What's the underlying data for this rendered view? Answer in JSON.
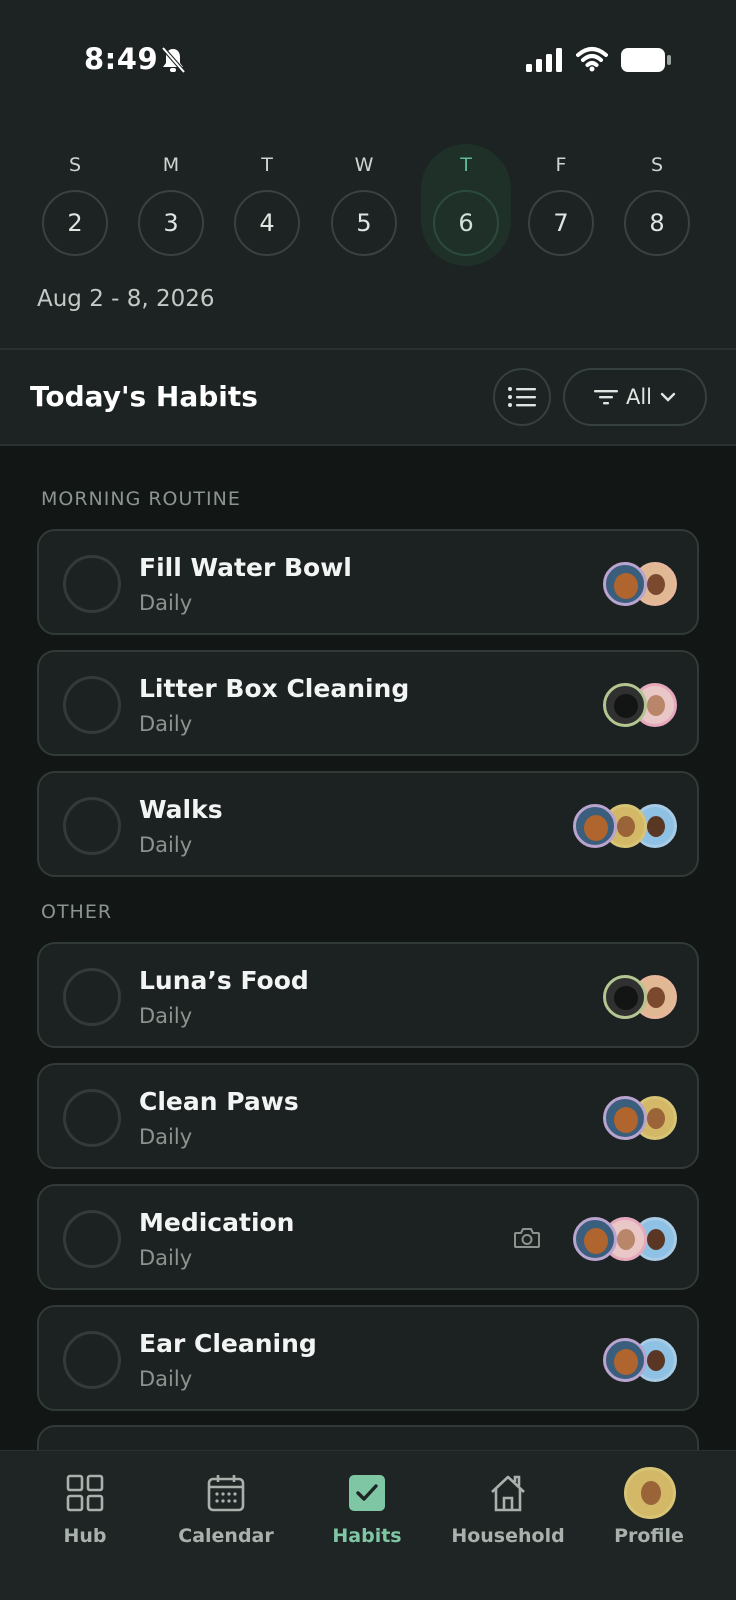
{
  "status_bar": {
    "time": "8:49"
  },
  "week": {
    "days": [
      {
        "dow": "S",
        "num": "2"
      },
      {
        "dow": "M",
        "num": "3"
      },
      {
        "dow": "T",
        "num": "4"
      },
      {
        "dow": "W",
        "num": "5"
      },
      {
        "dow": "T",
        "num": "6",
        "selected": true
      },
      {
        "dow": "F",
        "num": "7"
      },
      {
        "dow": "S",
        "num": "8"
      }
    ],
    "range": "Aug 2 - 8, 2026"
  },
  "habits_header": {
    "title": "Today's Habits",
    "filter_label": "All"
  },
  "sections": [
    {
      "label": "MORNING ROUTINE",
      "habits": [
        {
          "name": "Fill Water Bowl",
          "frequency": "Daily",
          "avatars": [
            "dog",
            "man1"
          ]
        },
        {
          "name": "Litter Box Cleaning",
          "frequency": "Daily",
          "avatars": [
            "cat",
            "woman1"
          ]
        },
        {
          "name": "Walks",
          "frequency": "Daily",
          "avatars": [
            "dog",
            "woman2",
            "man2"
          ]
        }
      ]
    },
    {
      "label": "OTHER",
      "habits": [
        {
          "name": "Luna’s Food",
          "frequency": "Daily",
          "avatars": [
            "cat",
            "man1"
          ]
        },
        {
          "name": "Clean Paws",
          "frequency": "Daily",
          "avatars": [
            "dog",
            "woman2"
          ]
        },
        {
          "name": "Medication",
          "frequency": "Daily",
          "avatars": [
            "dog",
            "woman1",
            "man2"
          ],
          "has_camera": true
        },
        {
          "name": "Ear Cleaning",
          "frequency": "Daily",
          "avatars": [
            "dog",
            "man2"
          ]
        }
      ]
    }
  ],
  "tabs": [
    {
      "label": "Hub",
      "icon": "grid-icon"
    },
    {
      "label": "Calendar",
      "icon": "calendar-icon"
    },
    {
      "label": "Habits",
      "icon": "habits-check-icon",
      "active": true
    },
    {
      "label": "Household",
      "icon": "house-icon"
    },
    {
      "label": "Profile",
      "icon": "profile-avatar"
    }
  ],
  "colors": {
    "accent": "#7fc6a5",
    "background": "#121716",
    "card": "#1c2221"
  }
}
